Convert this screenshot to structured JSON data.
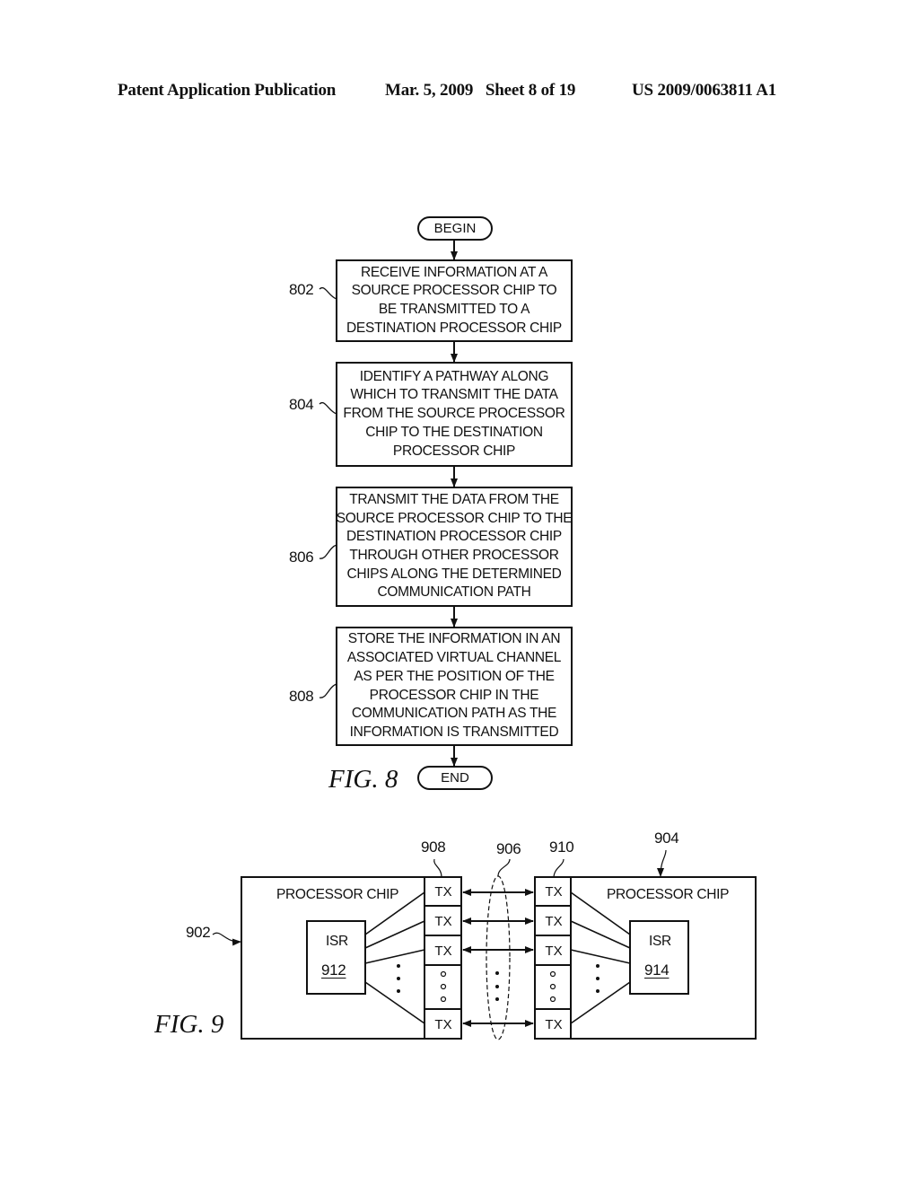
{
  "header": {
    "publication": "Patent Application Publication",
    "date_sheet": "Mar. 5, 2009   Sheet 8 of 19",
    "number": "US 2009/0063811 A1"
  },
  "fig8": {
    "caption": "FIG. 8",
    "begin": "BEGIN",
    "end": "END",
    "steps": [
      {
        "ref": "802",
        "lines": [
          "RECEIVE INFORMATION AT A",
          "SOURCE PROCESSOR CHIP TO",
          "BE TRANSMITTED TO A",
          "DESTINATION PROCESSOR CHIP"
        ]
      },
      {
        "ref": "804",
        "lines": [
          "IDENTIFY A PATHWAY ALONG",
          "WHICH TO TRANSMIT THE DATA",
          "FROM THE SOURCE PROCESSOR",
          "CHIP TO THE DESTINATION",
          "PROCESSOR CHIP"
        ]
      },
      {
        "ref": "806",
        "lines": [
          "TRANSMIT THE DATA FROM THE",
          "SOURCE PROCESSOR CHIP TO THE",
          "DESTINATION PROCESSOR CHIP",
          "THROUGH OTHER PROCESSOR",
          "CHIPS ALONG THE DETERMINED",
          "COMMUNICATION PATH"
        ]
      },
      {
        "ref": "808",
        "lines": [
          "STORE THE INFORMATION IN AN",
          "ASSOCIATED VIRTUAL CHANNEL",
          "AS PER THE POSITION OF THE",
          "PROCESSOR CHIP IN THE",
          "COMMUNICATION PATH AS THE",
          "INFORMATION IS TRANSMITTED"
        ]
      }
    ]
  },
  "fig9": {
    "caption": "FIG. 9",
    "left_chip": {
      "ref": "902",
      "label": "PROCESSOR CHIP",
      "isr_label": "ISR",
      "isr_ref": "912",
      "tx_ref": "908"
    },
    "right_chip": {
      "ref": "904",
      "label": "PROCESSOR CHIP",
      "isr_label": "ISR",
      "isr_ref": "914",
      "tx_ref": "910"
    },
    "link_ref": "906",
    "tx_label": "TX"
  }
}
